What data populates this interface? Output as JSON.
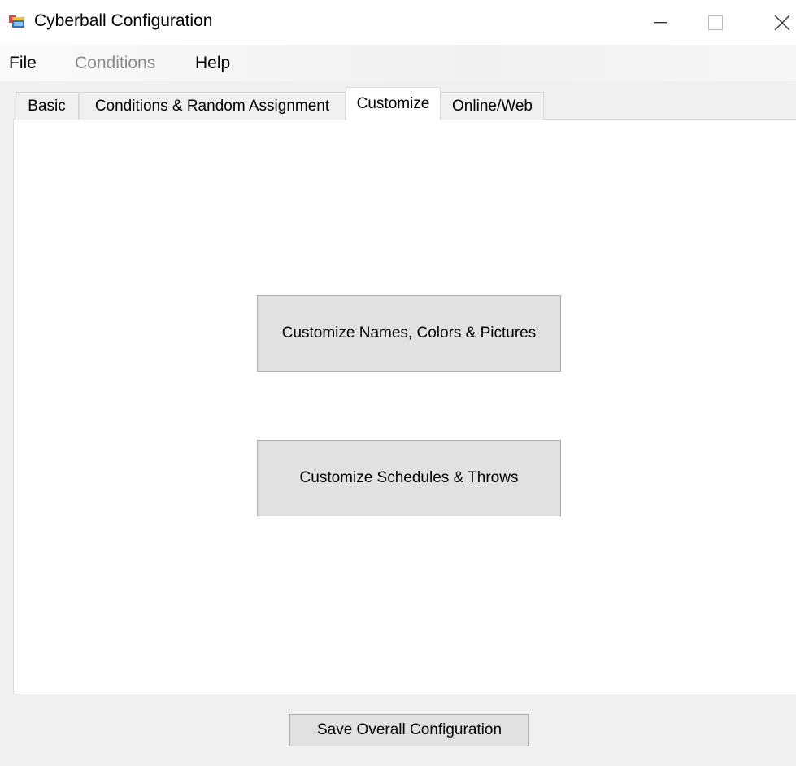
{
  "window": {
    "title": "Cyberball Configuration",
    "controls": {
      "minimize": "minimize-icon",
      "maximize": "maximize-icon",
      "close": "close-icon"
    }
  },
  "menu": {
    "file": "File",
    "conditions": "Conditions",
    "help": "Help"
  },
  "tabs": [
    {
      "label": "Basic"
    },
    {
      "label": "Conditions & Random Assignment"
    },
    {
      "label": "Customize",
      "selected": true
    },
    {
      "label": "Online/Web"
    }
  ],
  "customize": {
    "names_button": "Customize Names, Colors & Pictures",
    "schedules_button": "Customize Schedules & Throws"
  },
  "footer": {
    "save_button": "Save Overall Configuration"
  },
  "colors": {
    "window_bg": "#f0f0f0",
    "panel_bg": "#ffffff",
    "button_bg": "#e1e1e1",
    "disabled_text": "#8a8a8a"
  }
}
